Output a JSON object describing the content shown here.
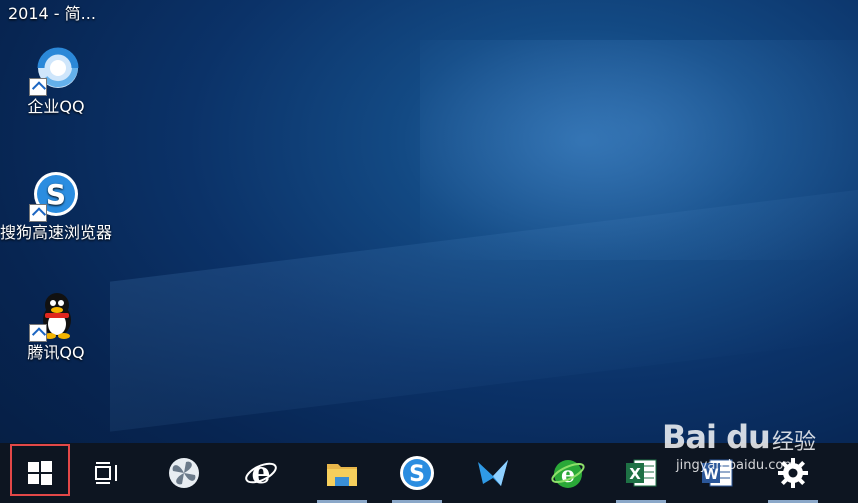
{
  "window_title": "2014 - 简...",
  "desktop": {
    "icons": [
      {
        "label": "企业QQ",
        "icon": "enterprise-qq-icon"
      },
      {
        "label": "搜狗高速浏览器",
        "icon": "sogou-browser-icon"
      },
      {
        "label": "腾讯QQ",
        "icon": "tencent-qq-icon"
      }
    ]
  },
  "taskbar": {
    "items": [
      {
        "name": "start-button",
        "icon": "windows-logo-icon"
      },
      {
        "name": "task-view-button",
        "icon": "task-view-icon"
      },
      {
        "name": "app-pinwheel",
        "icon": "pinwheel-icon"
      },
      {
        "name": "internet-explorer",
        "icon": "ie-icon"
      },
      {
        "name": "file-explorer",
        "icon": "folder-icon"
      },
      {
        "name": "sogou-browser",
        "icon": "sogou-icon"
      },
      {
        "name": "xunlei",
        "icon": "bird-icon"
      },
      {
        "name": "360-browser",
        "icon": "360-browser-icon"
      },
      {
        "name": "excel",
        "icon": "excel-icon"
      },
      {
        "name": "word",
        "icon": "word-icon"
      },
      {
        "name": "settings",
        "icon": "gear-icon"
      }
    ]
  },
  "watermark": {
    "main": "Bai du",
    "sub": "经验",
    "url": "jingyan.baidu.com"
  },
  "colors": {
    "taskbar_bg": "#0d1521",
    "highlight": "#e24848",
    "desktop_dark": "#061d41"
  }
}
